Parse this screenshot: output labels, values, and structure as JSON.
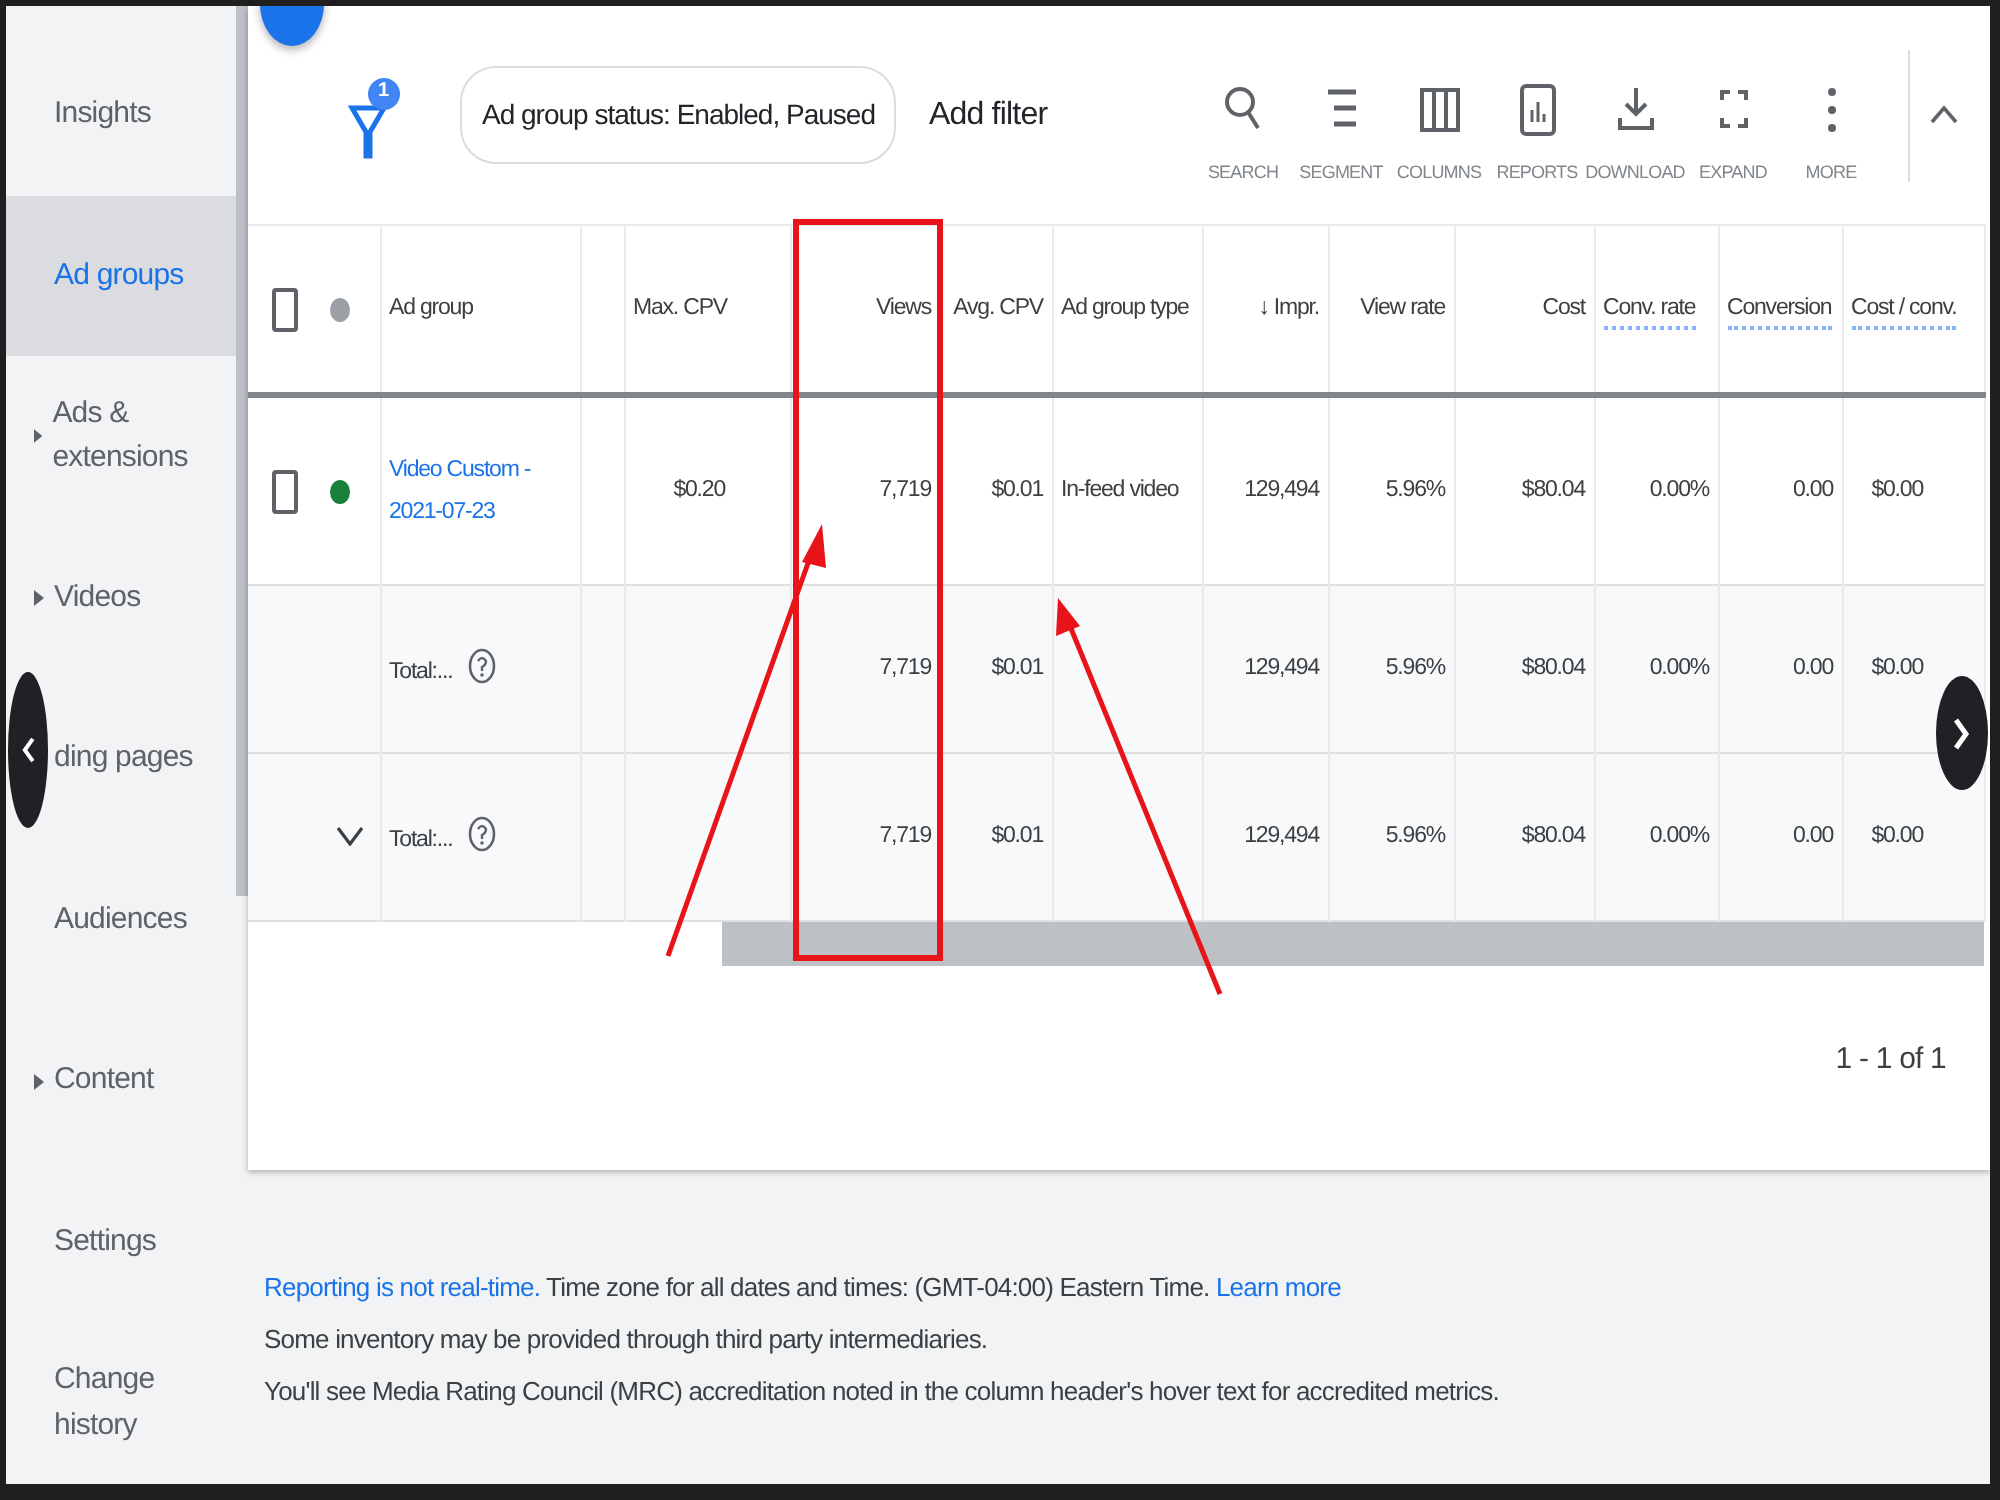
{
  "sidebar": {
    "items": [
      {
        "label": "Insights",
        "selected": false,
        "expandable": false
      },
      {
        "label": "Ad groups",
        "selected": true,
        "expandable": false
      },
      {
        "label": "Ads & extensions",
        "selected": false,
        "expandable": true
      },
      {
        "label": "Videos",
        "selected": false,
        "expandable": true
      },
      {
        "label": "ding pages",
        "selected": false
      },
      {
        "label": "Audiences",
        "selected": false,
        "expandable": false
      },
      {
        "label": "Content",
        "selected": false,
        "expandable": true
      },
      {
        "label": "Settings",
        "selected": false,
        "expandable": false
      },
      {
        "label": "Change history",
        "selected": false,
        "expandable": false
      }
    ]
  },
  "filter_bar": {
    "filter_count": "1",
    "chip": "Ad group status: Enabled, Paused",
    "add_filter": "Add filter"
  },
  "toolbar": [
    {
      "kind": "search",
      "label": "SEARCH"
    },
    {
      "kind": "segment",
      "label": "SEGMENT"
    },
    {
      "kind": "columns",
      "label": "COLUMNS"
    },
    {
      "kind": "reports",
      "label": "REPORTS"
    },
    {
      "kind": "download",
      "label": "DOWNLOAD"
    },
    {
      "kind": "expand",
      "label": "EXPAND"
    },
    {
      "kind": "more",
      "label": "MORE"
    }
  ],
  "table": {
    "columns": [
      {
        "label": "Ad group",
        "hint": false
      },
      {
        "label": "Max. CPV",
        "hint": false
      },
      {
        "label": "Views",
        "hint": false
      },
      {
        "label": "Avg. CPV",
        "hint": false
      },
      {
        "label": "Ad group type",
        "hint": false
      },
      {
        "label": "↓ Impr.",
        "hint": false
      },
      {
        "label": "View rate",
        "hint": false
      },
      {
        "label": "Cost",
        "hint": false
      },
      {
        "label": "Conv. rate",
        "hint": true
      },
      {
        "label": "Conversion",
        "hint": true
      },
      {
        "label": "Cost / conv.",
        "hint": true
      }
    ],
    "select_all_checked": false,
    "rows": [
      {
        "kind": "item",
        "checked": false,
        "color": "#188038",
        "cells": [
          "Video Custom - 2021-07-23",
          "$0.20",
          "7,719",
          "$0.01",
          "In-feed video",
          "129,494",
          "5.96%",
          "$80.04",
          "0.00%",
          "0.00",
          "$0.00"
        ]
      },
      {
        "kind": "total",
        "expanded": false,
        "cells": [
          "Total:...",
          "",
          "7,719",
          "$0.01",
          "",
          "129,494",
          "5.96%",
          "$80.04",
          "0.00%",
          "0.00",
          "$0.00"
        ]
      },
      {
        "kind": "total",
        "expanded": true,
        "cells": [
          "Total:...",
          "",
          "7,719",
          "$0.01",
          "",
          "129,494",
          "5.96%",
          "$80.04",
          "0.00%",
          "0.00",
          "$0.00"
        ]
      }
    ],
    "pagination": "1 - 1 of 1"
  },
  "footer": [
    [
      {
        "text": "Reporting is not real-time.",
        "link": true
      },
      {
        "text": " Time zone for all dates and times: (GMT-04:00) Eastern Time. ",
        "link": false
      },
      {
        "text": "Learn more",
        "link": true
      }
    ],
    [
      {
        "text": "Some inventory may be provided through third party intermediaries.",
        "link": false
      }
    ],
    [
      {
        "text": "You'll see Media Rating Council (MRC) accreditation noted in the column header's hover text for accredited metrics.",
        "link": false
      }
    ]
  ]
}
